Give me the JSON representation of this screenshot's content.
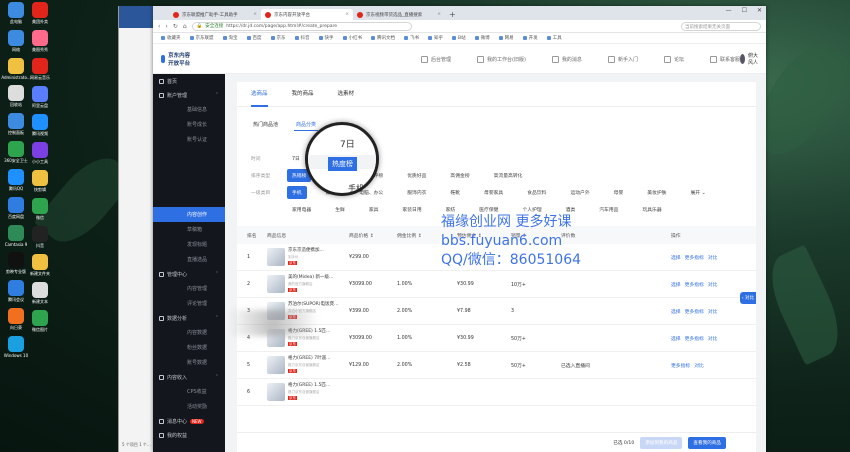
{
  "desktop": {
    "col1": [
      {
        "label": "此电脑",
        "color": "#3d8be0"
      },
      {
        "label": "网络",
        "color": "#3d8be0"
      },
      {
        "label": "Administrato...",
        "color": "#f0c040"
      },
      {
        "label": "回收站",
        "color": "#dddddd"
      },
      {
        "label": "控制面板",
        "color": "#3d8be0"
      },
      {
        "label": "360安全卫士",
        "color": "#2ea44f"
      },
      {
        "label": "腾讯QQ",
        "color": "#1e90ff"
      },
      {
        "label": "百度网盘",
        "color": "#2f7de1"
      },
      {
        "label": "Camtasia 9",
        "color": "#2e8b57"
      },
      {
        "label": "剪映专业版",
        "color": "#111111"
      },
      {
        "label": "腾讯会议",
        "color": "#2f7de1"
      },
      {
        "label": "向日葵",
        "color": "#f07020"
      },
      {
        "label": "Windows 10",
        "color": "#1aa0e0"
      }
    ],
    "col2": [
      {
        "label": "美团外卖",
        "color": "#e1251b"
      },
      {
        "label": "美图秀秀",
        "color": "#ff6a8a"
      },
      {
        "label": "网易云音乐",
        "color": "#e1251b"
      },
      {
        "label": "阿里云盘",
        "color": "#5a7cff"
      },
      {
        "label": "腾讯视频",
        "color": "#1e90ff"
      },
      {
        "label": "小小工具",
        "color": "#7b3fe4"
      },
      {
        "label": "快剪辑",
        "color": "#f0c040"
      },
      {
        "label": "微信",
        "color": "#2ea44f"
      },
      {
        "label": "抖音",
        "color": "#222222"
      },
      {
        "label": "新建文件夹",
        "color": "#f0c040"
      },
      {
        "label": "新建文本",
        "color": "#dddddd"
      },
      {
        "label": "微信图片",
        "color": "#2ea44f"
      }
    ]
  },
  "bgwindow": {
    "status": "5 个项目 1 个..."
  },
  "browser": {
    "tabs": [
      {
        "title": "京东联盟推广助手-工具助手"
      },
      {
        "title": "京东内容开放平台"
      },
      {
        "title": "京东视频带货选品_直播搜索"
      }
    ],
    "new_tab": "+",
    "win_min": "—",
    "win_max": "☐",
    "win_close": "✕",
    "nav": {
      "back": "‹",
      "fwd": "›",
      "reload": "↻",
      "home": "⌂"
    },
    "security": "安全连接",
    "url": "https://dr.jd.com/page/app.html#/create_prepare",
    "search_placeholder": "当前搜索结果无关页面",
    "bookmarks": [
      "收藏夹",
      "京东联盟",
      "淘宝",
      "百度",
      "京东",
      "抖音",
      "快手",
      "小红书",
      "腾讯文档",
      "飞书",
      "知乎",
      "B站",
      "微博",
      "网易",
      "开发",
      "工具"
    ]
  },
  "app": {
    "logo": "京东内容开放平台",
    "topnav": [
      "后台管理",
      "我的工作台(旧版)",
      "我的消息",
      "新手入门",
      "论坛",
      "联系客服"
    ],
    "user": "俯大风人"
  },
  "sidebar": [
    {
      "label": "首页",
      "type": "top",
      "icon": "home-icon"
    },
    {
      "label": "账户管理",
      "type": "top",
      "arrow": "⌃",
      "icon": "user-icon"
    },
    {
      "label": "基础信息",
      "type": "sub"
    },
    {
      "label": "账号成长",
      "type": "sub"
    },
    {
      "label": "账号认证",
      "type": "sub"
    },
    {
      "label": "",
      "type": "sub"
    },
    {
      "label": "",
      "type": "sub"
    },
    {
      "label": "",
      "type": "sub"
    },
    {
      "label": "",
      "type": "sub"
    },
    {
      "label": "内容创作",
      "type": "sub",
      "active": true
    },
    {
      "label": "草稿箱",
      "type": "sub"
    },
    {
      "label": "发现标题",
      "type": "sub"
    },
    {
      "label": "直播选品",
      "type": "sub"
    },
    {
      "label": "管理中心",
      "type": "top",
      "arrow": "⌃",
      "icon": "folder-icon"
    },
    {
      "label": "内容管理",
      "type": "sub"
    },
    {
      "label": "评论管理",
      "type": "sub"
    },
    {
      "label": "数据分析",
      "type": "top",
      "arrow": "⌃",
      "icon": "chart-icon"
    },
    {
      "label": "内容数据",
      "type": "sub"
    },
    {
      "label": "粉丝数据",
      "type": "sub"
    },
    {
      "label": "账号数据",
      "type": "sub"
    },
    {
      "label": "内容收入",
      "type": "top",
      "arrow": "⌃",
      "icon": "money-icon"
    },
    {
      "label": "CPS收益",
      "type": "sub"
    },
    {
      "label": "活动奖励",
      "type": "sub"
    },
    {
      "label": "消息中心",
      "type": "top",
      "badge": "NEW",
      "icon": "bell-icon"
    },
    {
      "label": "我的权益",
      "type": "top",
      "icon": "gift-icon"
    }
  ],
  "main": {
    "tabs": [
      "选商品",
      "我的商品",
      "选素材"
    ],
    "subtabs": [
      "热门商品池",
      "商品分类"
    ],
    "filter_rows": [
      {
        "label": "时间",
        "chips": [
          "7日"
        ]
      },
      {
        "label": "排序类型",
        "chips": [
          "热销榜",
          "热度榜",
          "好评榜",
          "优质好品",
          "高佣金榜",
          "高流量高转化"
        ]
      },
      {
        "label": "一级类目",
        "chips": [
          "手机",
          "数码",
          "电脑、办公",
          "服饰内衣",
          "鞋靴",
          "母婴家具",
          "食品饮料",
          "运动户外",
          "母婴",
          "美妆护肤",
          "展开 ⌄"
        ]
      },
      {
        "label": "",
        "chips": [
          "家用电器",
          "生鲜",
          "家具",
          "家装日用",
          "家纺",
          "医疗保健",
          "个人护理",
          "酒类",
          "汽车用品",
          "玩具乐器"
        ]
      }
    ],
    "table": {
      "headers": [
        "排名",
        "商品信息",
        "商品价格 ↕",
        "佣金比例 ↕",
        "预估佣金 ↕",
        "销量 ↕",
        "评价数",
        "操作"
      ],
      "rows": [
        {
          "rank": "1",
          "name": "京东京造便携加...",
          "sub": "到手价",
          "tag": "京东",
          "price": "¥299.00",
          "rate": "",
          "est": "",
          "sales": "",
          "reviews": "",
          "ops": [
            "选择",
            "更多指标",
            "对比"
          ]
        },
        {
          "rank": "2",
          "name": "美的(Midea) 新一级...",
          "sub": "美的官方旗舰店",
          "tag": "京东",
          "price": "¥3099.00",
          "rate": "1.00%",
          "est": "¥30.99",
          "sales": "10万+",
          "reviews": "",
          "ops": [
            "选择",
            "更多指标",
            "对比"
          ]
        },
        {
          "rank": "3",
          "name": "苏泊尔(SUPOR)电饭煲...",
          "sub": "苏泊尔官方旗舰店",
          "tag": "京东",
          "price": "¥399.00",
          "rate": "2.00%",
          "est": "¥7.98",
          "sales": "3",
          "reviews": "",
          "ops": [
            "选择",
            "更多指标",
            "对比"
          ]
        },
        {
          "rank": "4",
          "name": "格力(GREE) 1.5匹...",
          "sub": "格力京东自营旗舰店",
          "tag": "京东",
          "price": "¥3099.00",
          "rate": "1.00%",
          "est": "¥30.99",
          "sales": "50万+",
          "reviews": "",
          "ops": [
            "选择",
            "更多指标",
            "对比"
          ]
        },
        {
          "rank": "5",
          "name": "格力(GREE) 7叶遥...",
          "sub": "格力京东自营旗舰店",
          "tag": "京东",
          "price": "¥129.00",
          "rate": "2.00%",
          "est": "¥2.58",
          "sales": "50万+",
          "reviews": "已选入直播间",
          "ops": [
            "更多指标",
            "对比"
          ]
        },
        {
          "rank": "6",
          "name": "格力(GREE) 1.5匹...",
          "sub": "格力京东自营旗舰店",
          "tag": "京东",
          "price": "",
          "rate": "",
          "est": "",
          "sales": "",
          "reviews": "",
          "ops": []
        }
      ]
    },
    "float_btn": "‹ 对比",
    "footer": {
      "selected": "已选 0/10",
      "btn_add": "添加到我的商品",
      "btn_view": "查看我的商品"
    }
  },
  "magnifier": {
    "time": "7日",
    "chip": "热度榜",
    "cat": "手机"
  },
  "watermark": [
    "福缘创业网 更多好课",
    "bbs.fuyuan6.com",
    "QQ/微信：86051064"
  ]
}
